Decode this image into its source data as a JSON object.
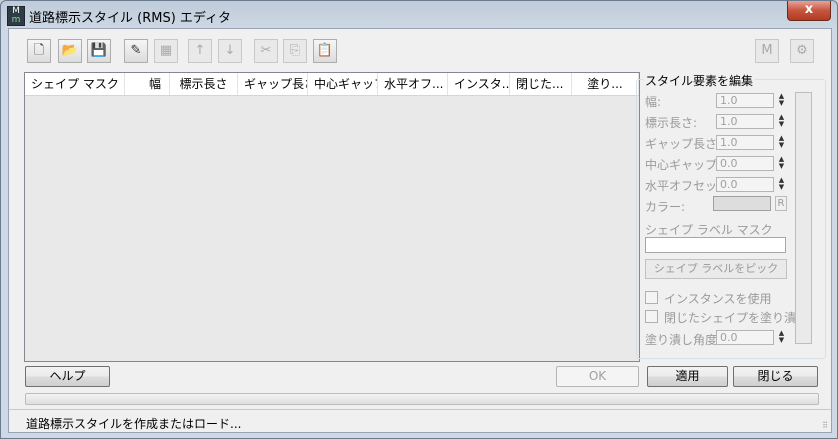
{
  "window": {
    "title": "道路標示スタイル (RMS) エディタ",
    "close_glyph": "x"
  },
  "app_icon": {
    "top": "M",
    "bottom": "m"
  },
  "toolbar": {
    "buttons": [
      {
        "name": "new-icon",
        "glyph": "🗋",
        "enabled": true
      },
      {
        "name": "open-folder-icon",
        "glyph": "📂",
        "enabled": true
      },
      {
        "name": "save-icon",
        "glyph": "💾",
        "enabled": true
      },
      {
        "name": "add-item-icon",
        "glyph": "✎",
        "enabled": true
      },
      {
        "name": "delete-item-icon",
        "glyph": "▦",
        "enabled": false
      },
      {
        "name": "move-up-icon",
        "glyph": "↑",
        "enabled": false
      },
      {
        "name": "move-down-icon",
        "glyph": "↓",
        "enabled": false
      },
      {
        "name": "cut-icon",
        "glyph": "✂",
        "enabled": false
      },
      {
        "name": "copy-icon",
        "glyph": "⎘",
        "enabled": false
      },
      {
        "name": "paste-icon",
        "glyph": "📋",
        "enabled": true
      }
    ],
    "m_label": "M",
    "settings_glyph": "⚙"
  },
  "list": {
    "columns": [
      "シェイプ マスク",
      "幅",
      "標示長さ",
      "ギャップ長さ",
      "中心ギャップ",
      "水平オフ...",
      "インスタ...",
      "閉じた...",
      "塗り..."
    ]
  },
  "edit_group": {
    "title": "スタイル要素を編集",
    "fields": [
      {
        "label": "幅:",
        "value": "1.0"
      },
      {
        "label": "標示長さ:",
        "value": "1.0"
      },
      {
        "label": "ギャップ長さ:",
        "value": "1.0"
      },
      {
        "label": "中心ギャップ:",
        "value": "0.0"
      },
      {
        "label": "水平オフセット:",
        "value": "0.0"
      }
    ],
    "color_label": "カラー:",
    "color_value": "#dddddd",
    "r_label": "R",
    "shape_label_mask_label": "シェイプ ラベル マスク",
    "pick_button": "シェイプ ラベルをピック",
    "use_instance": "インスタンスを使用",
    "fill_closed": "閉じたシェイプを塗り潰す",
    "fill_angle_label": "塗り潰し角度:",
    "fill_angle_value": "0.0"
  },
  "buttons": {
    "help": "ヘルプ",
    "ok": "OK",
    "apply": "適用",
    "close": "閉じる"
  },
  "progress": 0,
  "status": "道路標示スタイルを作成またはロード..."
}
